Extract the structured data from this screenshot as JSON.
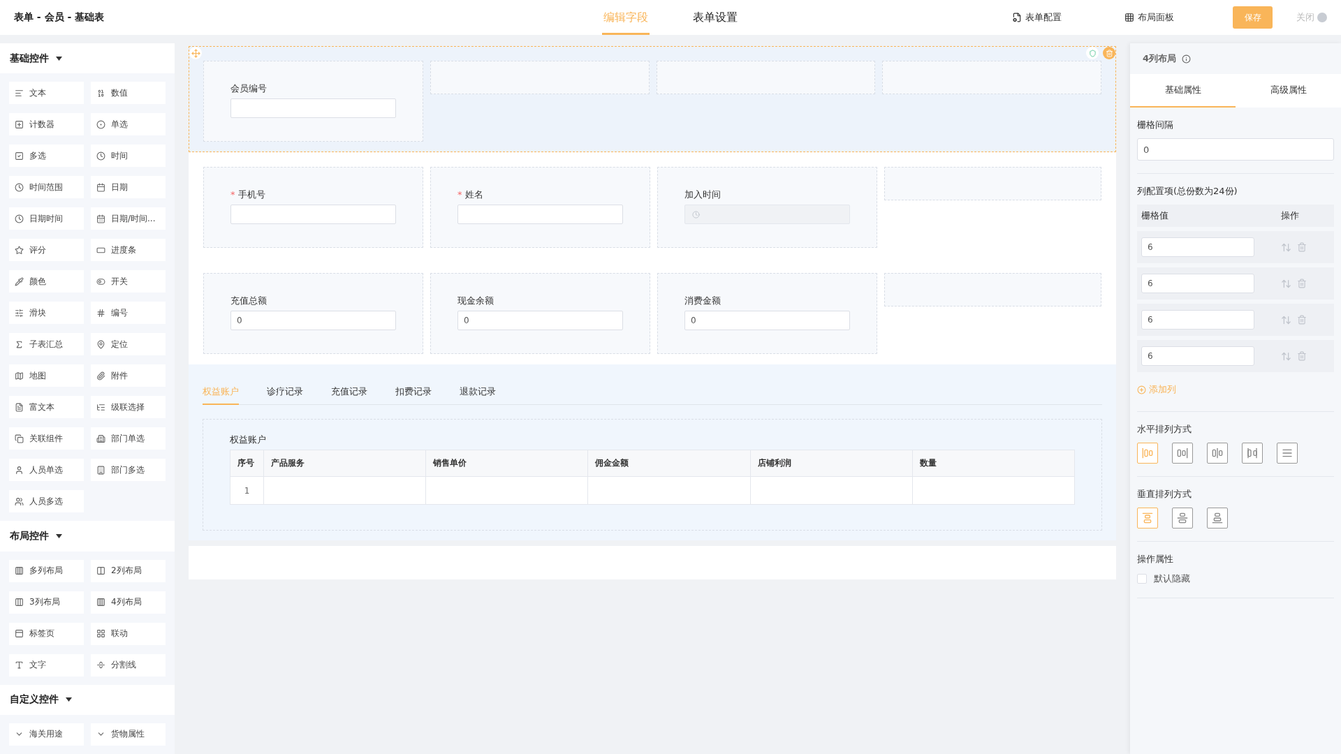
{
  "header": {
    "title": "表单 - 会员 - 基础表",
    "tabs": [
      {
        "label": "编辑字段",
        "selected": true
      },
      {
        "label": "表单设置",
        "selected": false
      }
    ],
    "actions": [
      {
        "label": "表单配置",
        "kind": "config"
      },
      {
        "label": "布局面板",
        "kind": "grid"
      }
    ],
    "save": "保存",
    "close": "关闭"
  },
  "sidebar": {
    "sections": [
      {
        "title": "基础控件",
        "expanded": true,
        "items": [
          {
            "label": "文本"
          },
          {
            "label": "数值"
          },
          {
            "label": "计数器"
          },
          {
            "label": "单选"
          },
          {
            "label": "多选"
          },
          {
            "label": "时间"
          },
          {
            "label": "时间范围"
          },
          {
            "label": "日期"
          },
          {
            "label": "日期时间"
          },
          {
            "label": "日期/时间..."
          },
          {
            "label": "评分"
          },
          {
            "label": "进度条"
          },
          {
            "label": "颜色"
          },
          {
            "label": "开关"
          },
          {
            "label": "滑块"
          },
          {
            "label": "编号"
          },
          {
            "label": "子表汇总"
          },
          {
            "label": "定位"
          },
          {
            "label": "地图"
          },
          {
            "label": "附件"
          },
          {
            "label": "富文本"
          },
          {
            "label": "级联选择"
          },
          {
            "label": "关联组件"
          },
          {
            "label": "部门单选"
          },
          {
            "label": "人员单选"
          },
          {
            "label": "部门多选"
          },
          {
            "label": "人员多选"
          }
        ]
      },
      {
        "title": "布局控件",
        "expanded": true,
        "items": [
          {
            "label": "多列布局"
          },
          {
            "label": "2列布局"
          },
          {
            "label": "3列布局"
          },
          {
            "label": "4列布局"
          },
          {
            "label": "标签页"
          },
          {
            "label": "联动"
          },
          {
            "label": "文字"
          },
          {
            "label": "分割线"
          }
        ]
      },
      {
        "title": "自定义控件",
        "expanded": true,
        "items": [
          {
            "label": "海关用途"
          },
          {
            "label": "货物属性"
          }
        ]
      }
    ]
  },
  "canvas": {
    "required_mark": "*",
    "rows": [
      {
        "selected": true,
        "cells": [
          {
            "kind": "input",
            "label": "会员编号",
            "required": false
          },
          {
            "kind": "empty"
          },
          {
            "kind": "empty"
          },
          {
            "kind": "empty"
          }
        ]
      },
      {
        "selected": false,
        "cells": [
          {
            "kind": "input",
            "label": "手机号",
            "required": true
          },
          {
            "kind": "input",
            "label": "姓名",
            "required": true
          },
          {
            "kind": "date",
            "label": "加入时间",
            "required": false
          },
          {
            "kind": "empty"
          }
        ]
      },
      {
        "selected": false,
        "cells": [
          {
            "kind": "input",
            "label": "充值总额",
            "required": false,
            "value": "0"
          },
          {
            "kind": "input",
            "label": "现金余额",
            "required": false,
            "value": "0"
          },
          {
            "kind": "input",
            "label": "消费金额",
            "required": false,
            "value": "0"
          },
          {
            "kind": "empty"
          }
        ]
      }
    ],
    "tabs": [
      {
        "label": "权益账户",
        "selected": true
      },
      {
        "label": "诊疗记录",
        "selected": false
      },
      {
        "label": "充值记录",
        "selected": false
      },
      {
        "label": "扣费记录",
        "selected": false
      },
      {
        "label": "退款记录",
        "selected": false
      }
    ],
    "subtable": {
      "title": "权益账户",
      "columns": [
        "序号",
        "产品服务",
        "销售单价",
        "佣金金额",
        "店铺利润",
        "数量"
      ],
      "rows": [
        {
          "index": "1"
        }
      ]
    }
  },
  "panel": {
    "title": "4列布局",
    "tabs": [
      {
        "label": "基础属性",
        "selected": true
      },
      {
        "label": "高级属性",
        "selected": false
      }
    ],
    "gutter": {
      "label": "栅格间隔",
      "value": "0"
    },
    "columns": {
      "label": "列配置项(总份数为24份)",
      "headers": [
        "栅格值",
        "操作"
      ],
      "rows": [
        {
          "value": "6"
        },
        {
          "value": "6"
        },
        {
          "value": "6"
        },
        {
          "value": "6"
        }
      ],
      "add_label": "添加列"
    },
    "horizontal": {
      "label": "水平排列方式",
      "options": [
        {
          "selected": true
        },
        {
          "selected": false
        },
        {
          "selected": false
        },
        {
          "selected": false
        },
        {
          "selected": false
        }
      ]
    },
    "vertical": {
      "label": "垂直排列方式",
      "options": [
        {
          "selected": true
        },
        {
          "selected": false
        },
        {
          "selected": false
        }
      ]
    },
    "operations": {
      "label": "操作属性",
      "checkbox": {
        "label": "默认隐藏",
        "checked": false
      }
    }
  }
}
